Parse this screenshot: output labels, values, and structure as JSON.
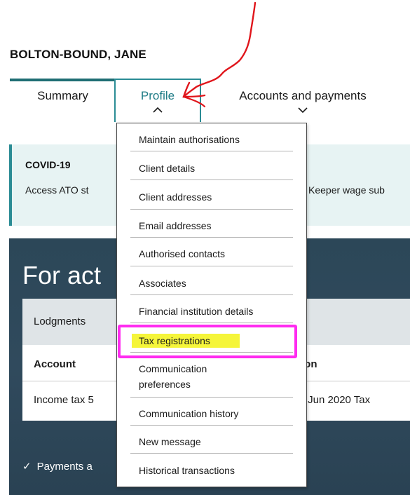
{
  "client": {
    "name": "BOLTON-BOUND, JANE"
  },
  "tabs": {
    "summary": "Summary",
    "profile": "Profile",
    "accounts": "Accounts and payments",
    "chevron_up": "⌃",
    "chevron_down": "⌄"
  },
  "covid": {
    "title": "COVID-19",
    "text_left": "Access ATO st",
    "text_right": "Keeper wage sub"
  },
  "action": {
    "heading": "For act",
    "lodgments": "Lodgments",
    "columns": {
      "account": "Account",
      "description": "ion"
    },
    "row": {
      "account": "Income tax 5",
      "description": "- Jun 2020 Tax"
    },
    "payments": "Payments a",
    "tick": "✓"
  },
  "profile_menu": {
    "items": [
      "Maintain authorisations",
      "Client details",
      "Client addresses",
      "Email addresses",
      "Authorised contacts",
      "Associates",
      "Financial institution details",
      "Tax registrations",
      "Communication preferences",
      "Communication history",
      "New message",
      "Historical transactions"
    ],
    "highlighted_item": "Tax registrations"
  },
  "annotation": {
    "arrow_color": "#e0151b",
    "box_color": "#ff2bf0",
    "highlight_color": "#f5f53a"
  }
}
